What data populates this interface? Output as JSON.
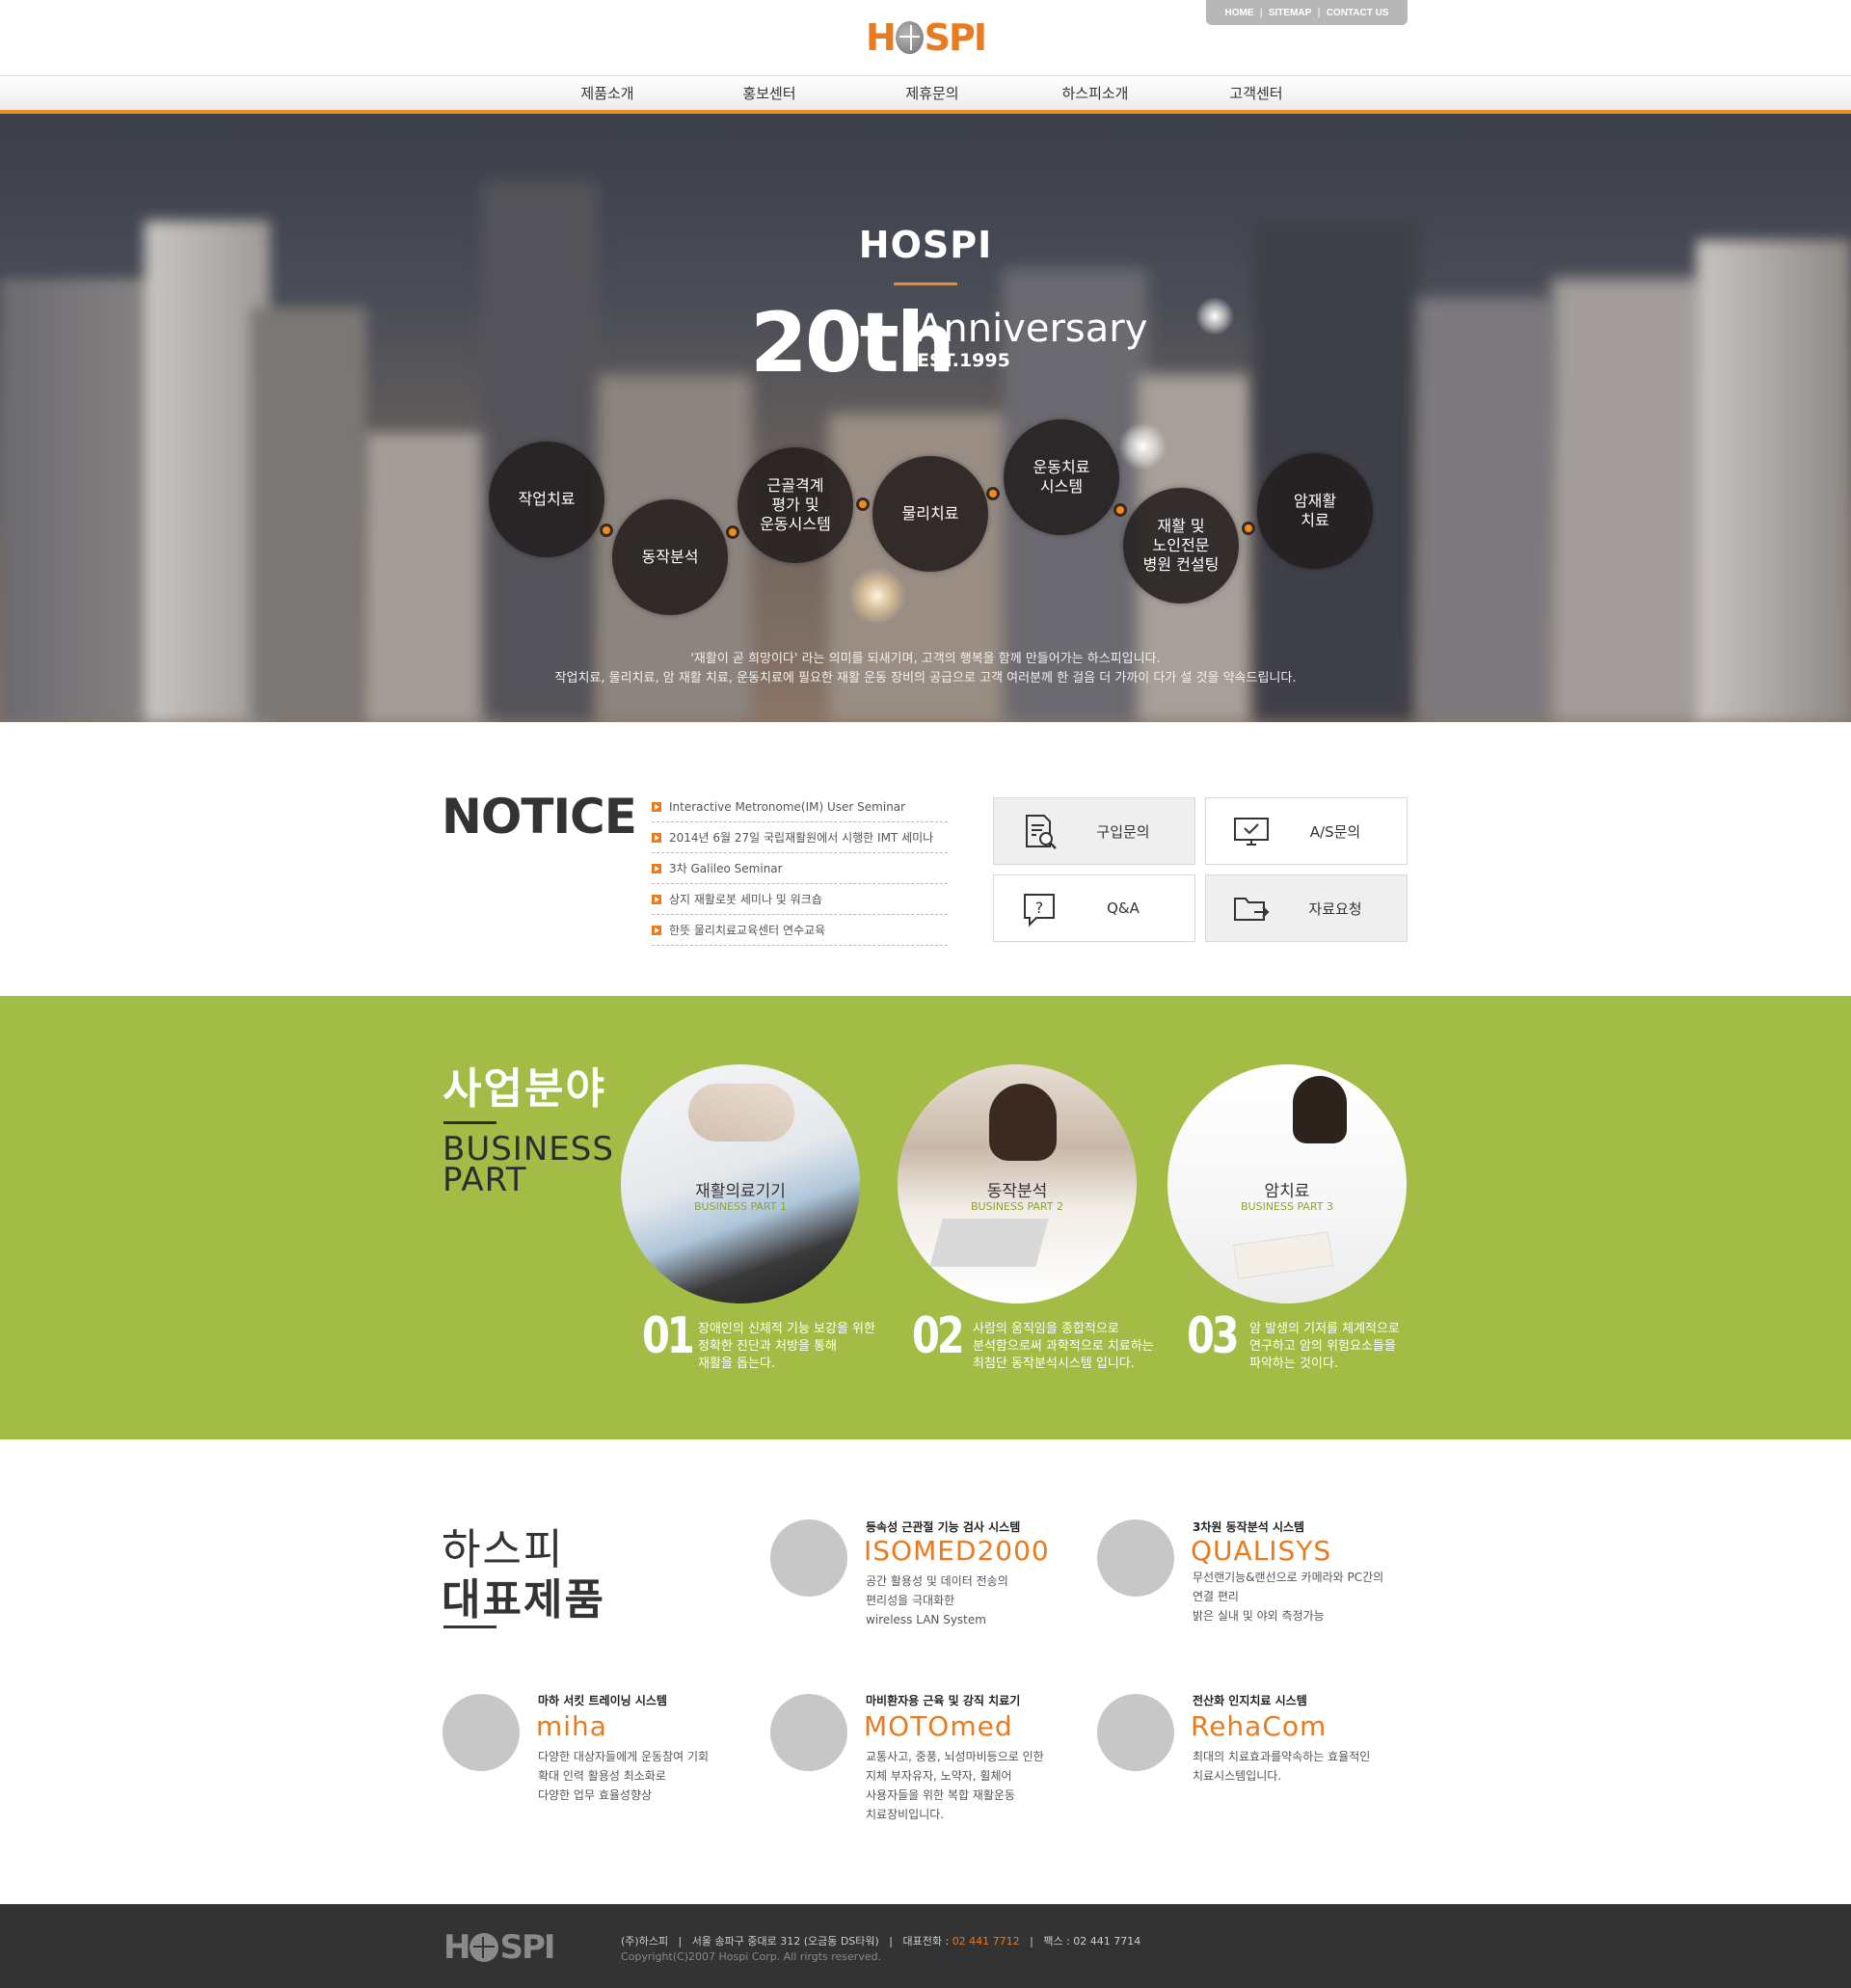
{
  "header": {
    "logo": {
      "pre": "H",
      "post": "SPI"
    },
    "util_links": [
      "HOME",
      "SITEMAP",
      "CONTACT US"
    ],
    "util_sep": "|"
  },
  "nav": [
    "제품소개",
    "홍보센터",
    "제휴문의",
    "하스피소개",
    "고객센터"
  ],
  "hero": {
    "title": "HOSPI",
    "number": "20th",
    "anniversary": "Anniversary",
    "est": "EST.1995",
    "circles": [
      {
        "lines": [
          "작업치료"
        ]
      },
      {
        "lines": [
          "동작분석"
        ]
      },
      {
        "lines": [
          "근골격계",
          "평가 및",
          "운동시스템"
        ]
      },
      {
        "lines": [
          "물리치료"
        ]
      },
      {
        "lines": [
          "운동치료",
          "시스템"
        ]
      },
      {
        "lines": [
          "재활 및",
          "노인전문",
          "병원 컨설팅"
        ]
      },
      {
        "lines": [
          "암재활",
          "치료"
        ]
      }
    ],
    "text_line1": "'재활이 곧 희망이다' 라는 의미를 되새기며, 고객의 행복을 함께 만들어가는 하스피입니다.",
    "text_line2": "작업치료, 물리치료, 암 재활 치료, 운동치료에 필요한 재활 운동 장비의 공급으로 고객 여러분께 한 걸음 더 가까이 다가 설 것을 약속드립니다."
  },
  "notice": {
    "title": "NOTICE",
    "items": [
      "Interactive Metronome(IM) User Seminar",
      "2014년 6월 27일 국립재활원에서 시행한 IMT 세미나",
      "3차 Galileo Seminar",
      "상지 재활로봇 세미나 및 워크숍",
      "한뜻 물리치료교육센터 연수교육"
    ]
  },
  "quick": [
    {
      "label": "구입문의",
      "icon": "document-search-icon"
    },
    {
      "label": "A/S문의",
      "icon": "monitor-check-icon"
    },
    {
      "label": "Q&A",
      "icon": "question-bubble-icon"
    },
    {
      "label": "자료요청",
      "icon": "folder-arrow-icon"
    }
  ],
  "business": {
    "title": "사업분야",
    "eng_line1": "BUSINESS",
    "eng_line2": "PART",
    "parts": [
      {
        "name": "재활의료기기",
        "sub": "BUSINESS PART 1",
        "num": "01",
        "desc": [
          "장애인의 신체적 기능 보강을 위한",
          "정확한 진단과 처방을 통해",
          "재활을 돕는다."
        ]
      },
      {
        "name": "동작분석",
        "sub": "BUSINESS PART 2",
        "num": "02",
        "desc": [
          "사람의 움직임을 종합적으로",
          "분석함으로써 과학적으로 치료하는",
          "최첨단 동작분석시스템 입니다."
        ]
      },
      {
        "name": "암치료",
        "sub": "BUSINESS PART 3",
        "num": "03",
        "desc": [
          "암 발생의 기저를 체계적으로",
          "연구하고 암의 위험요소들을",
          "파악하는 것이다."
        ]
      }
    ]
  },
  "products": {
    "title1": "하스피",
    "title2": "대표제품",
    "items": [
      {
        "cat": "등속성 근관절 기능 검사 시스템",
        "name": "ISOMED2000",
        "desc": [
          "공간 활용성 및 데이터 전송의",
          "편리성을 극대화한",
          "wireless LAN System"
        ]
      },
      {
        "cat": "3차원 동작분석 시스템",
        "name": "QUALISYS",
        "desc": [
          "무선랜기능&랜선으로 카메라와 PC간의",
          "연결 편리",
          "밝은 실내 및 야외 측정가능"
        ]
      },
      {
        "cat": "마하 서킷 트레이닝 시스템",
        "name": "miha",
        "desc": [
          "다양한 대상자들에게 운동참여 기회",
          "확대 인력 활용성 최소화로",
          "다양한 업무 효율성향상"
        ]
      },
      {
        "cat": "마비환자용 근육 및 강직 치료기",
        "name": "MOTOmed",
        "desc": [
          "교통사고, 중풍, 뇌성마비등으로 인한",
          "지체 부자유자, 노약자, 휠체어",
          "사용자들을 위한 복합 재활운동",
          "치료장비입니다."
        ]
      },
      {
        "cat": "전산화 인지치료 시스템",
        "name": "RehaCom",
        "desc": [
          "최대의  치료효과를약속하는 효율적인",
          "치료시스템입니다."
        ]
      }
    ]
  },
  "footer": {
    "logo_pre": "H",
    "logo_post": "SPI",
    "info_pre": "(주)하스피   |   서울 송파구 중대로 312 (오금동 DS타워)   |   대표전화 : ",
    "phone": "02 441 7712",
    "info_post": "   |   팩스 : 02 441 7714",
    "copyright": "Copyright(C)2007 Hospi Corp. All rirgts reserved."
  },
  "colors": {
    "accent": "#e87a1f",
    "green": "#a3bc45",
    "footer": "#333333"
  }
}
